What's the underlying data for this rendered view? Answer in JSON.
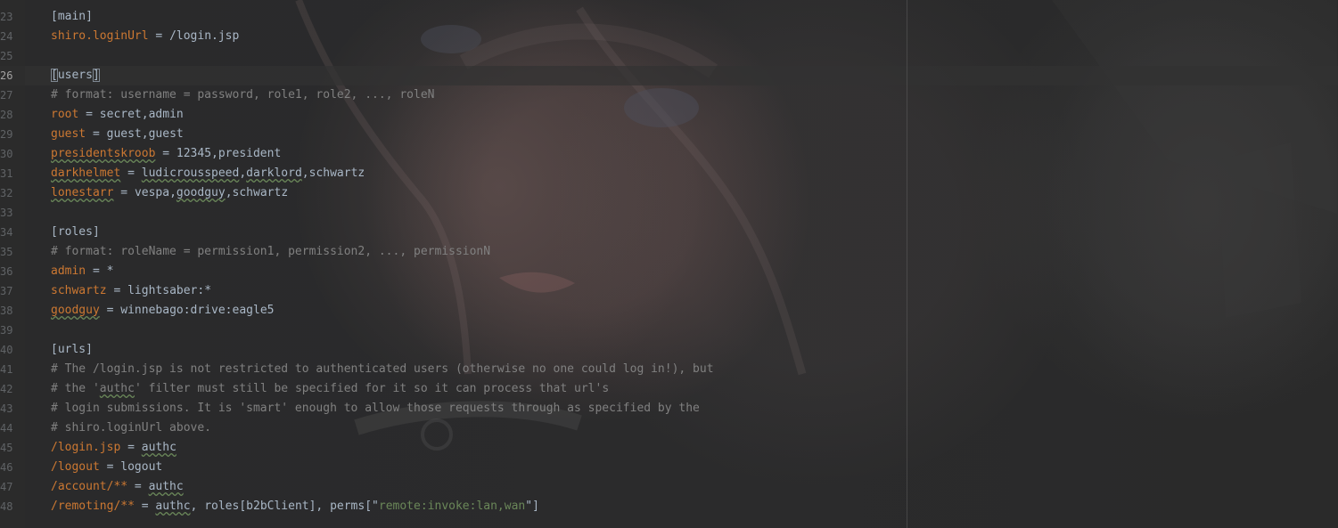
{
  "colors": {
    "background": "#2b2b2b",
    "text": "#a9b7c6",
    "key": "#cc7832",
    "comment": "#808080",
    "string": "#6a8759",
    "line_number": "#606366",
    "line_number_current": "#a4a3a3",
    "current_line_highlight": "#323232",
    "spell_underline": "#6a8759"
  },
  "editor": {
    "current_line": "26",
    "lines": [
      {
        "number": "23",
        "tokens": [
          {
            "text": "[main]",
            "style": "section"
          }
        ]
      },
      {
        "number": "24",
        "tokens": [
          {
            "text": "shiro.loginUrl",
            "style": "key"
          },
          {
            "text": " = ",
            "style": "op"
          },
          {
            "text": "/login.jsp",
            "style": "val"
          }
        ]
      },
      {
        "number": "25",
        "tokens": []
      },
      {
        "number": "26",
        "tokens": [
          {
            "text": "[",
            "style": "section-bracket",
            "caret": true
          },
          {
            "text": "users",
            "style": "section"
          },
          {
            "text": "]",
            "style": "section-bracket",
            "caret": true
          }
        ]
      },
      {
        "number": "27",
        "tokens": [
          {
            "text": "# format: username = password, role1, role2, ..., roleN",
            "style": "comment"
          }
        ]
      },
      {
        "number": "28",
        "tokens": [
          {
            "text": "root",
            "style": "key"
          },
          {
            "text": " = ",
            "style": "op"
          },
          {
            "text": "secret,admin",
            "style": "val"
          }
        ]
      },
      {
        "number": "29",
        "tokens": [
          {
            "text": "guest",
            "style": "key"
          },
          {
            "text": " = ",
            "style": "op"
          },
          {
            "text": "guest,guest",
            "style": "val"
          }
        ]
      },
      {
        "number": "30",
        "tokens": [
          {
            "text": "presidentskroob",
            "style": "key",
            "typo": true
          },
          {
            "text": " = ",
            "style": "op"
          },
          {
            "text": "12345,president",
            "style": "val"
          }
        ]
      },
      {
        "number": "31",
        "tokens": [
          {
            "text": "darkhelmet",
            "style": "key",
            "typo": true
          },
          {
            "text": " = ",
            "style": "op"
          },
          {
            "text": "ludicrousspeed",
            "style": "val",
            "typo": true
          },
          {
            "text": ",",
            "style": "val"
          },
          {
            "text": "darklord",
            "style": "val",
            "typo": true
          },
          {
            "text": ",schwartz",
            "style": "val"
          }
        ]
      },
      {
        "number": "32",
        "tokens": [
          {
            "text": "lonestarr",
            "style": "key",
            "typo": true
          },
          {
            "text": " = ",
            "style": "op"
          },
          {
            "text": "vespa,",
            "style": "val"
          },
          {
            "text": "goodguy",
            "style": "val",
            "typo": true
          },
          {
            "text": ",schwartz",
            "style": "val"
          }
        ]
      },
      {
        "number": "33",
        "tokens": []
      },
      {
        "number": "34",
        "tokens": [
          {
            "text": "[roles]",
            "style": "section"
          }
        ]
      },
      {
        "number": "35",
        "tokens": [
          {
            "text": "# format: roleName = permission1, permission2, ..., permissionN",
            "style": "comment"
          }
        ]
      },
      {
        "number": "36",
        "tokens": [
          {
            "text": "admin",
            "style": "key"
          },
          {
            "text": " = ",
            "style": "op"
          },
          {
            "text": "*",
            "style": "val"
          }
        ]
      },
      {
        "number": "37",
        "tokens": [
          {
            "text": "schwartz",
            "style": "key"
          },
          {
            "text": " = ",
            "style": "op"
          },
          {
            "text": "lightsaber:*",
            "style": "val"
          }
        ]
      },
      {
        "number": "38",
        "tokens": [
          {
            "text": "goodguy",
            "style": "key",
            "typo": true
          },
          {
            "text": " = ",
            "style": "op"
          },
          {
            "text": "winnebago:drive:eagle5",
            "style": "val"
          }
        ]
      },
      {
        "number": "39",
        "tokens": []
      },
      {
        "number": "40",
        "tokens": [
          {
            "text": "[urls]",
            "style": "section"
          }
        ]
      },
      {
        "number": "41",
        "tokens": [
          {
            "text": "# The /login.jsp is not restricted to authenticated users (otherwise no one could log in!), but",
            "style": "comment"
          }
        ]
      },
      {
        "number": "42",
        "tokens": [
          {
            "text": "# the '",
            "style": "comment"
          },
          {
            "text": "authc",
            "style": "comment",
            "typo": true
          },
          {
            "text": "' filter must still be specified for it so it can process that url's",
            "style": "comment"
          }
        ]
      },
      {
        "number": "43",
        "tokens": [
          {
            "text": "# login submissions. It is 'smart' enough to allow those requests through as specified by the",
            "style": "comment"
          }
        ]
      },
      {
        "number": "44",
        "tokens": [
          {
            "text": "# shiro.loginUrl above.",
            "style": "comment"
          }
        ]
      },
      {
        "number": "45",
        "tokens": [
          {
            "text": "/login.jsp",
            "style": "key"
          },
          {
            "text": " = ",
            "style": "op"
          },
          {
            "text": "authc",
            "style": "val",
            "typo": true
          }
        ]
      },
      {
        "number": "46",
        "tokens": [
          {
            "text": "/logout",
            "style": "key"
          },
          {
            "text": " = ",
            "style": "op"
          },
          {
            "text": "logout",
            "style": "val"
          }
        ]
      },
      {
        "number": "47",
        "tokens": [
          {
            "text": "/account/**",
            "style": "key"
          },
          {
            "text": " = ",
            "style": "op"
          },
          {
            "text": "authc",
            "style": "val",
            "typo": true
          }
        ]
      },
      {
        "number": "48",
        "tokens": [
          {
            "text": "/remoting/**",
            "style": "key"
          },
          {
            "text": " = ",
            "style": "op"
          },
          {
            "text": "authc",
            "style": "val",
            "typo": true
          },
          {
            "text": ", roles[b2bClient], perms[\"",
            "style": "val"
          },
          {
            "text": "remote:invoke:lan,wan",
            "style": "string"
          },
          {
            "text": "\"]",
            "style": "val"
          }
        ]
      }
    ]
  }
}
